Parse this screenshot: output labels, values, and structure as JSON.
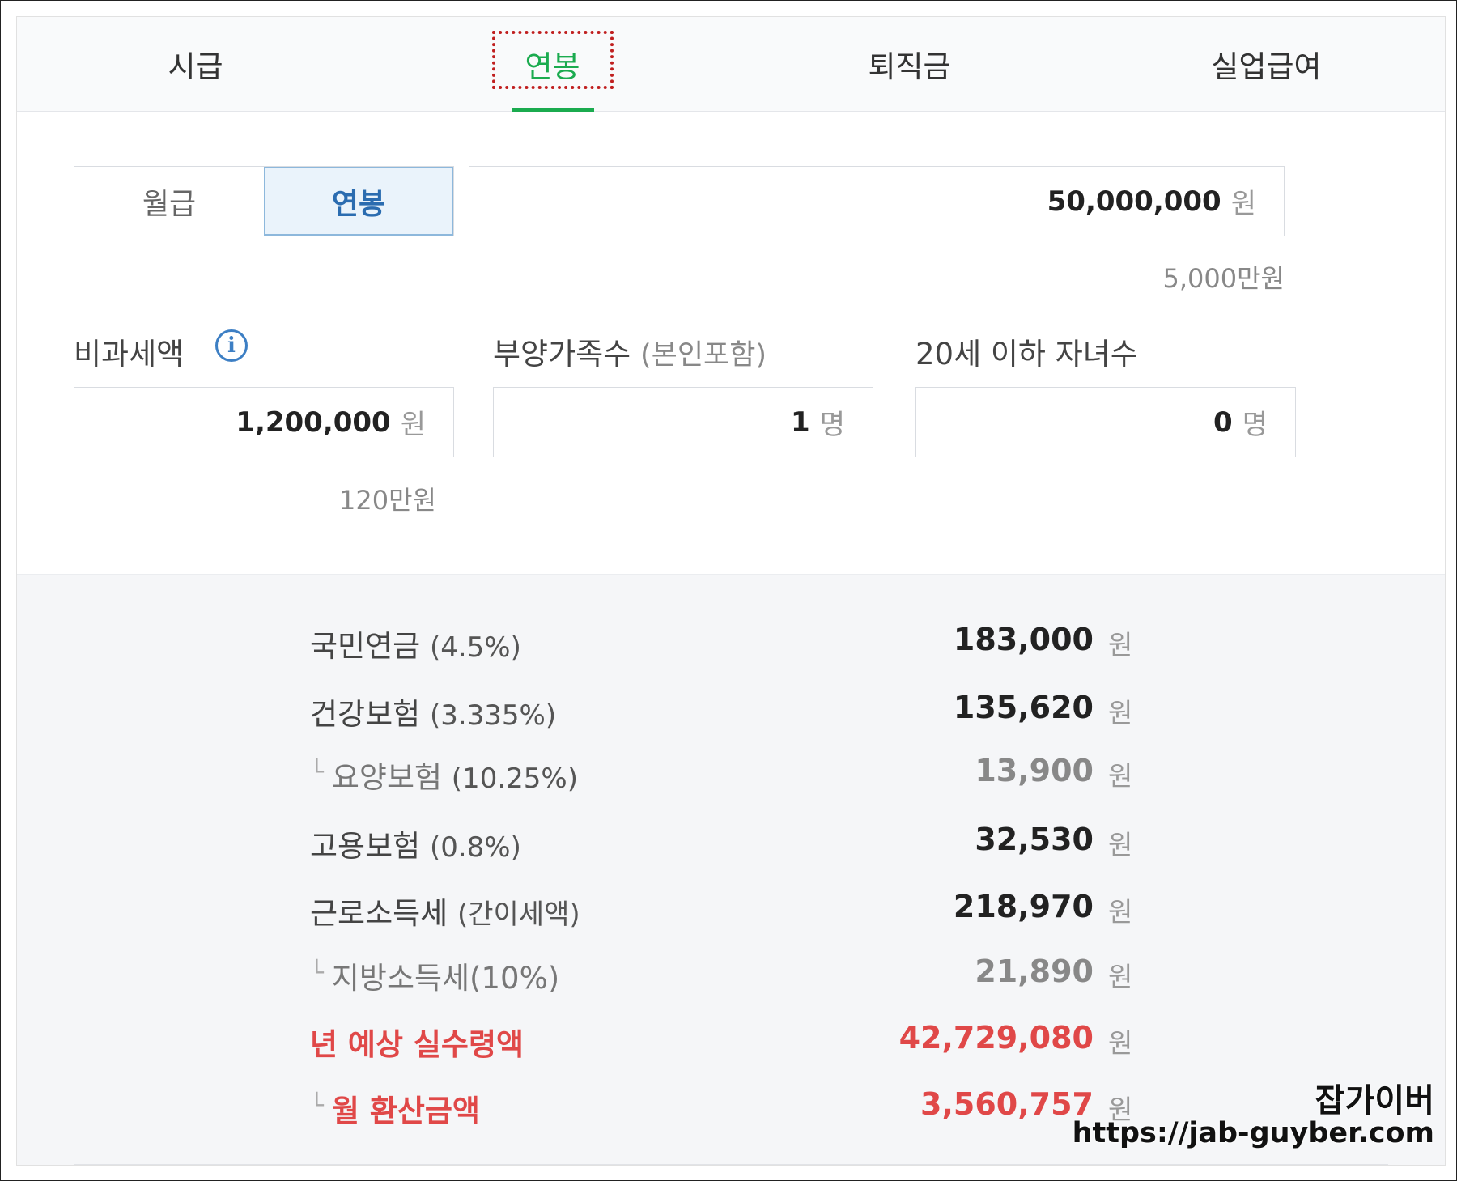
{
  "tabs": [
    {
      "label": "시급"
    },
    {
      "label": "연봉"
    },
    {
      "label": "퇴직금"
    },
    {
      "label": "실업급여"
    }
  ],
  "salary_type": {
    "options": [
      "월급",
      "연봉"
    ],
    "selected": "연봉"
  },
  "salary_input": {
    "value": "50,000,000",
    "unit": "원",
    "hint": "5,000만원"
  },
  "nontaxable": {
    "label": "비과세액",
    "value": "1,200,000",
    "unit": "원",
    "hint": "120만원"
  },
  "dependents": {
    "label": "부양가족수",
    "label_sub": "(본인포함)",
    "value": "1",
    "unit": "명"
  },
  "children": {
    "label": "20세 이하 자녀수",
    "value": "0",
    "unit": "명"
  },
  "results": [
    {
      "name": "국민연금",
      "pct": "(4.5%)",
      "amount": "183,000",
      "unit": "원"
    },
    {
      "name": "건강보험",
      "pct": "(3.335%)",
      "amount": "135,620",
      "unit": "원"
    },
    {
      "name": "요양보험",
      "pct": "(10.25%)",
      "amount": "13,900",
      "unit": "원"
    },
    {
      "name": "고용보험",
      "pct": "(0.8%)",
      "amount": "32,530",
      "unit": "원"
    },
    {
      "name": "근로소득세",
      "pct": "(간이세액)",
      "amount": "218,970",
      "unit": "원"
    },
    {
      "name": "지방소득세(10%)",
      "pct": "",
      "amount": "21,890",
      "unit": "원"
    },
    {
      "name": "년 예상 실수령액",
      "pct": "",
      "amount": "42,729,080",
      "unit": "원"
    },
    {
      "name": "월 환산금액",
      "pct": "",
      "amount": "3,560,757",
      "unit": "원"
    }
  ],
  "watermark": {
    "name": "잡가이버",
    "url": "https://jab-guyber.com"
  },
  "colors": {
    "active_tab": "#1bab4f",
    "highlight": "#c01f1f",
    "total_red": "#e04848",
    "selected_blue": "#2b6cb0"
  }
}
